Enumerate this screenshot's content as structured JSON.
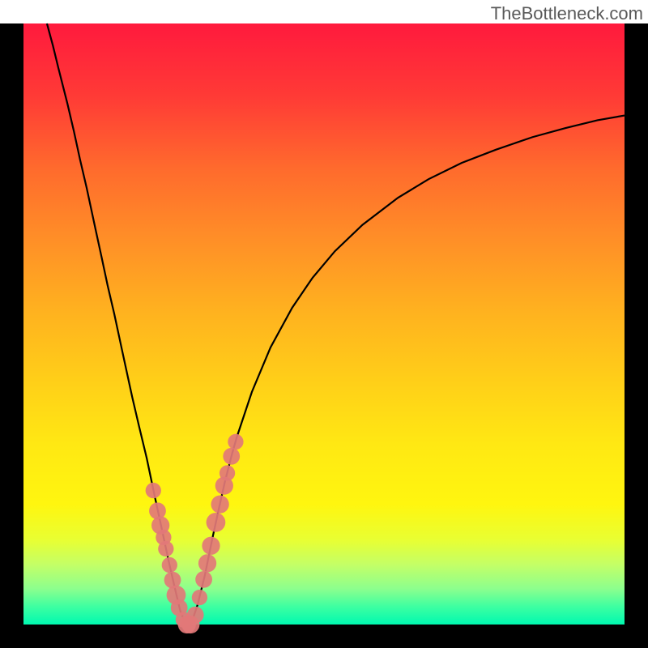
{
  "watermark": "TheBottleneck.com",
  "chart_data": {
    "type": "line",
    "title": "",
    "xlabel": "",
    "ylabel": "",
    "xlim": [
      0,
      100
    ],
    "ylim": [
      0,
      100
    ],
    "series": [
      {
        "name": "curve-left",
        "kind": "line",
        "points": [
          {
            "x": 3.9,
            "y": 100.0
          },
          {
            "x": 4.9,
            "y": 96.3
          },
          {
            "x": 5.8,
            "y": 92.6
          },
          {
            "x": 7.3,
            "y": 86.7
          },
          {
            "x": 8.4,
            "y": 82.0
          },
          {
            "x": 9.4,
            "y": 77.4
          },
          {
            "x": 10.5,
            "y": 72.7
          },
          {
            "x": 12.0,
            "y": 65.7
          },
          {
            "x": 13.0,
            "y": 61.1
          },
          {
            "x": 14.0,
            "y": 56.4
          },
          {
            "x": 15.1,
            "y": 51.7
          },
          {
            "x": 16.3,
            "y": 46.1
          },
          {
            "x": 17.1,
            "y": 42.4
          },
          {
            "x": 18.1,
            "y": 37.8
          },
          {
            "x": 19.2,
            "y": 33.1
          },
          {
            "x": 20.5,
            "y": 27.7
          },
          {
            "x": 21.8,
            "y": 21.5
          },
          {
            "x": 22.8,
            "y": 16.9
          },
          {
            "x": 24.1,
            "y": 10.8
          },
          {
            "x": 25.2,
            "y": 6.0
          },
          {
            "x": 26.1,
            "y": 2.2
          },
          {
            "x": 27.0,
            "y": 0.1
          }
        ]
      },
      {
        "name": "curve-right",
        "kind": "line",
        "points": [
          {
            "x": 27.0,
            "y": 0.1
          },
          {
            "x": 27.9,
            "y": 0.1
          },
          {
            "x": 29.0,
            "y": 3.4
          },
          {
            "x": 30.2,
            "y": 8.3
          },
          {
            "x": 31.4,
            "y": 14.2
          },
          {
            "x": 32.6,
            "y": 19.7
          },
          {
            "x": 33.5,
            "y": 23.7
          },
          {
            "x": 34.7,
            "y": 28.4
          },
          {
            "x": 35.5,
            "y": 31.2
          },
          {
            "x": 38.0,
            "y": 38.7
          },
          {
            "x": 41.1,
            "y": 46.1
          },
          {
            "x": 44.7,
            "y": 52.7
          },
          {
            "x": 48.1,
            "y": 57.7
          },
          {
            "x": 51.8,
            "y": 62.1
          },
          {
            "x": 56.4,
            "y": 66.5
          },
          {
            "x": 62.3,
            "y": 71.0
          },
          {
            "x": 67.4,
            "y": 74.1
          },
          {
            "x": 72.9,
            "y": 76.8
          },
          {
            "x": 78.6,
            "y": 79.0
          },
          {
            "x": 84.7,
            "y": 81.1
          },
          {
            "x": 90.2,
            "y": 82.6
          },
          {
            "x": 95.5,
            "y": 83.9
          },
          {
            "x": 100.0,
            "y": 84.7
          }
        ]
      },
      {
        "name": "markers",
        "kind": "scatter",
        "points": [
          {
            "x": 21.6,
            "y": 22.3,
            "r": 1.3
          },
          {
            "x": 22.3,
            "y": 18.9,
            "r": 1.4
          },
          {
            "x": 22.8,
            "y": 16.5,
            "r": 1.5
          },
          {
            "x": 23.3,
            "y": 14.5,
            "r": 1.3
          },
          {
            "x": 23.7,
            "y": 12.6,
            "r": 1.3
          },
          {
            "x": 24.3,
            "y": 9.9,
            "r": 1.3
          },
          {
            "x": 24.8,
            "y": 7.4,
            "r": 1.4
          },
          {
            "x": 25.4,
            "y": 4.9,
            "r": 1.6
          },
          {
            "x": 25.9,
            "y": 2.8,
            "r": 1.4
          },
          {
            "x": 26.6,
            "y": 0.8,
            "r": 1.3
          },
          {
            "x": 27.2,
            "y": 0.0,
            "r": 1.5
          },
          {
            "x": 27.8,
            "y": 0.0,
            "r": 1.5
          },
          {
            "x": 28.6,
            "y": 1.6,
            "r": 1.4
          },
          {
            "x": 29.3,
            "y": 4.5,
            "r": 1.3
          },
          {
            "x": 30.0,
            "y": 7.5,
            "r": 1.4
          },
          {
            "x": 30.6,
            "y": 10.2,
            "r": 1.5
          },
          {
            "x": 31.2,
            "y": 13.1,
            "r": 1.5
          },
          {
            "x": 32.0,
            "y": 17.0,
            "r": 1.6
          },
          {
            "x": 32.7,
            "y": 20.0,
            "r": 1.5
          },
          {
            "x": 33.4,
            "y": 23.1,
            "r": 1.5
          },
          {
            "x": 33.9,
            "y": 25.2,
            "r": 1.3
          },
          {
            "x": 34.6,
            "y": 28.0,
            "r": 1.4
          },
          {
            "x": 35.3,
            "y": 30.4,
            "r": 1.3
          }
        ]
      }
    ]
  }
}
